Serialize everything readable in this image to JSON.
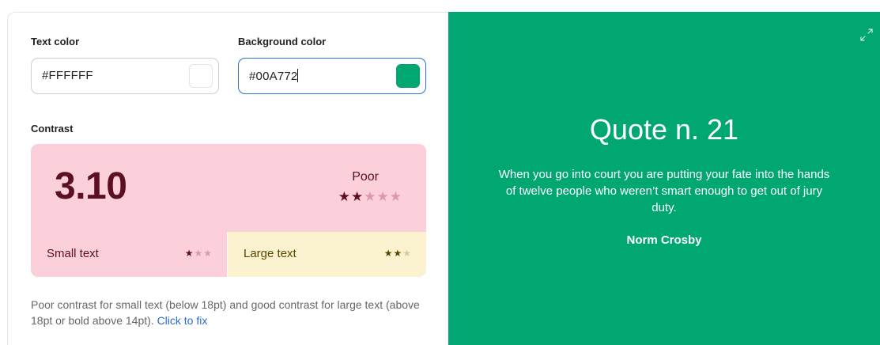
{
  "text_color": {
    "label": "Text color",
    "value": "#FFFFFF",
    "swatch": "#FFFFFF"
  },
  "background_color": {
    "label": "Background color",
    "value": "#00A772",
    "swatch": "#00A772"
  },
  "contrast": {
    "label": "Contrast",
    "ratio": "3.10",
    "rating": "Poor",
    "rating_stars": 2,
    "rating_stars_max": 5,
    "small_text": {
      "label": "Small text",
      "stars": 1,
      "max": 3
    },
    "large_text": {
      "label": "Large text",
      "stars": 2,
      "max": 3
    }
  },
  "note": {
    "text": "Poor contrast for small text (below 18pt) and good contrast for large text (above 18pt or bold above 14pt).",
    "link": "Click to fix"
  },
  "preview": {
    "title": "Quote n. 21",
    "quote": "When you go into court you are putting your fate into the hands of twelve people who weren’t smart enough to get out of jury duty.",
    "author": "Norm Crosby",
    "expand_icon": "expand-icon"
  },
  "colors": {
    "poor_bg": "#fbd0da",
    "poor_fg": "#5b0f21",
    "good_bg": "#fbf3cf",
    "good_fg": "#5a4300",
    "link": "#2a6bcf"
  }
}
